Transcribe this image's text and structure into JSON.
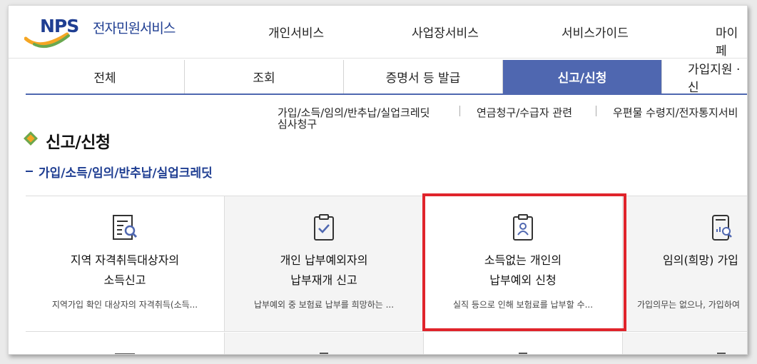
{
  "logo": {
    "brand": "NPS",
    "service": "전자민원서비스"
  },
  "gnb": [
    "개인서비스",
    "사업장서비스",
    "서비스가이드",
    "마이페"
  ],
  "tabs": [
    {
      "label": "전체",
      "active": false
    },
    {
      "label": "조회",
      "active": false
    },
    {
      "label": "증명서 등 발급",
      "active": false
    },
    {
      "label": "신고/신청",
      "active": true
    },
    {
      "label": "가입지원 · 신",
      "active": false
    }
  ],
  "sublinks": [
    "가입/소득/임의/반추납/실업크레딧",
    "연금청구/수급자 관련",
    "우편물 수령지/전자통지서비",
    "심사청구"
  ],
  "page_title": "신고/신청",
  "section_title": "가입/소득/임의/반추납/실업크레딧",
  "cards": [
    {
      "title1": "지역 자격취득대상자의",
      "title2": "소득신고",
      "desc": "지역가입 확인 대상자의 자격취득(소득...",
      "icon": "document-search-icon"
    },
    {
      "title1": "개인 납부예외자의",
      "title2": "납부재개 신고",
      "desc": "납부예외 중 보험료 납부를 희망하는 ...",
      "icon": "clipboard-check-icon"
    },
    {
      "title1": "소득없는 개인의",
      "title2": "납부예외 신청",
      "desc": "실직 등으로 인해 보험료를 납부할 수...",
      "icon": "clipboard-person-icon"
    },
    {
      "title1": "임의(희망) 가입",
      "title2": "",
      "desc": "가입의무는 없으나, 가입하여",
      "icon": "tablet-chart-icon"
    }
  ],
  "colors": {
    "brand": "#1f3e92",
    "tab_active": "#4f67b0",
    "highlight": "#e0242b"
  }
}
